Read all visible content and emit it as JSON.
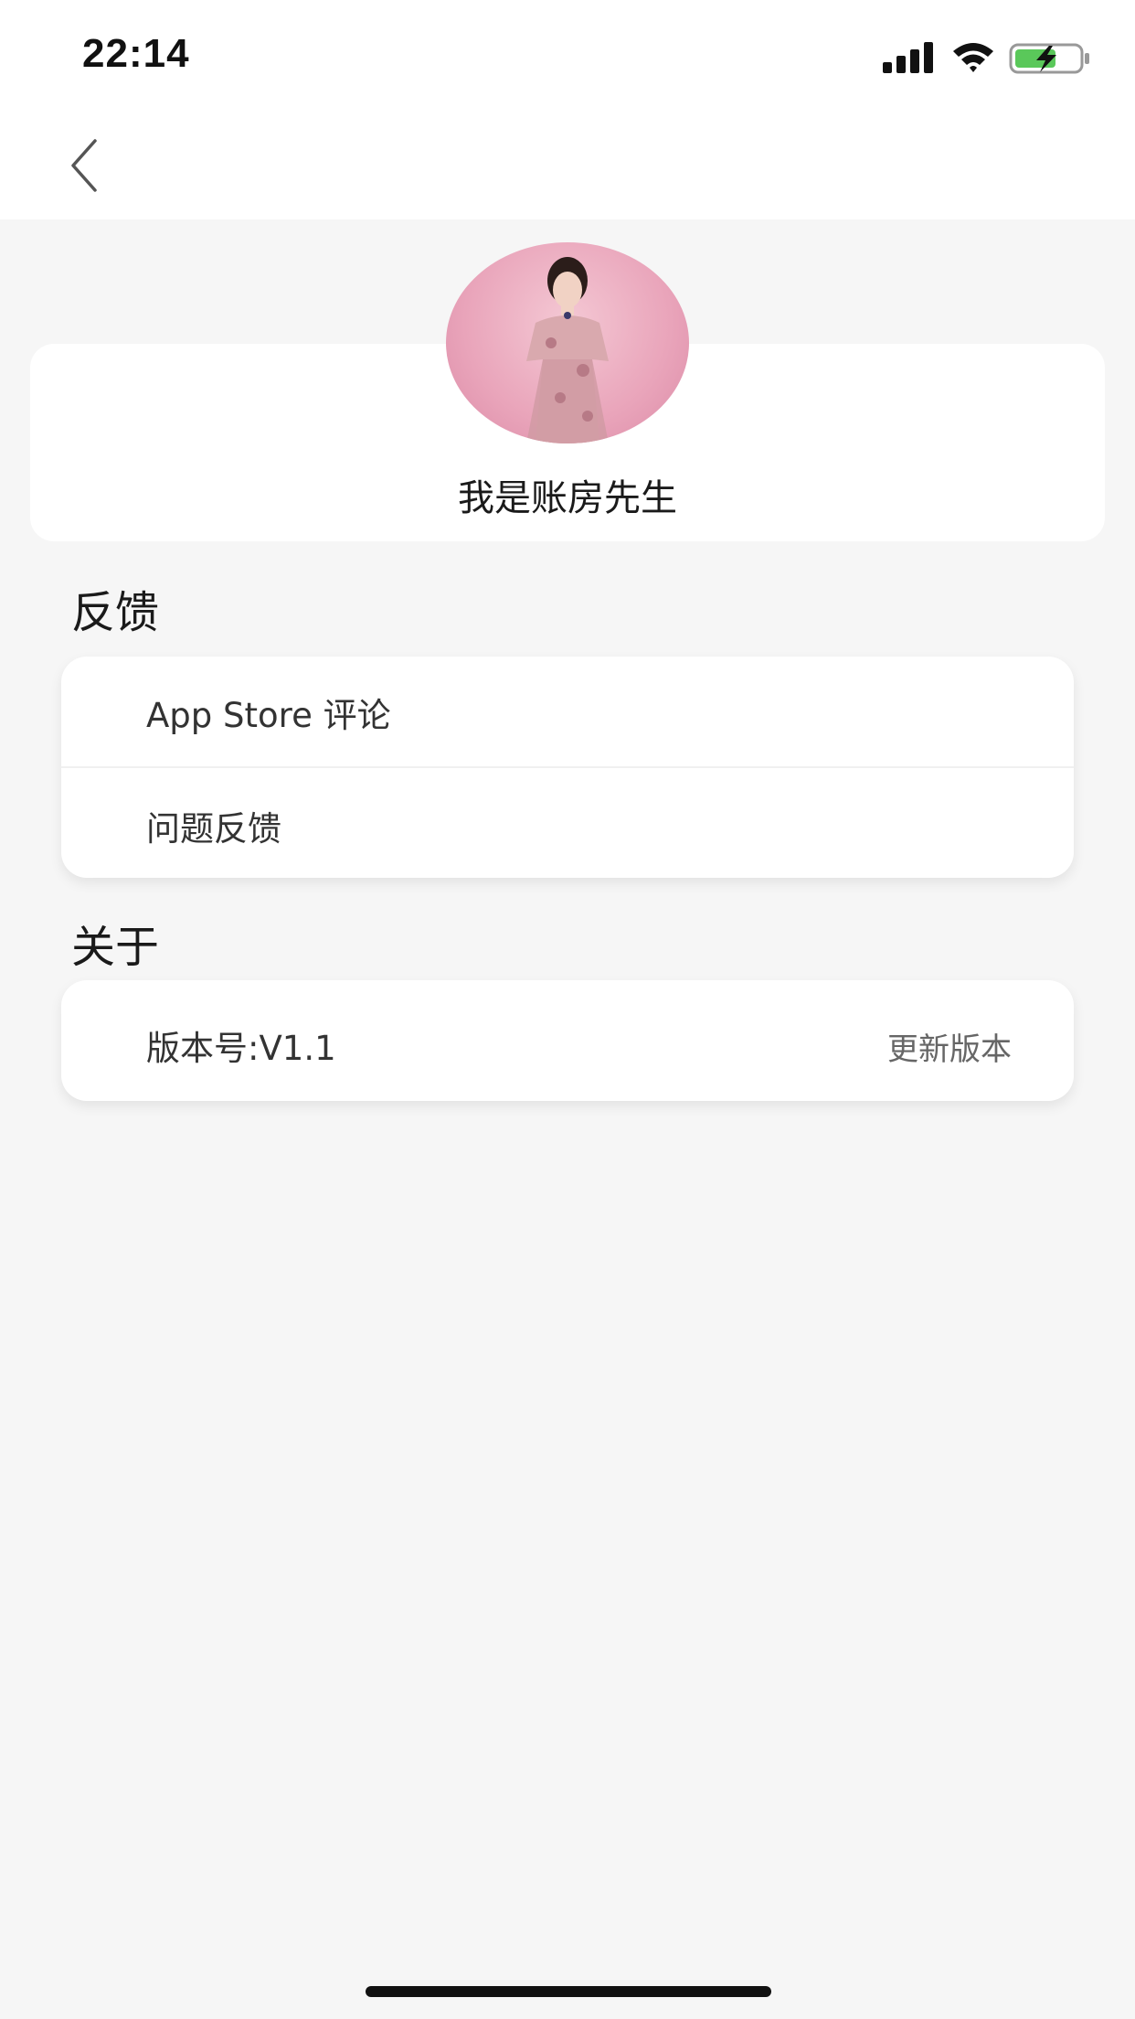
{
  "status_bar": {
    "time": "22:14",
    "icons": [
      "signal-icon",
      "wifi-icon",
      "battery-charging-icon"
    ]
  },
  "nav": {
    "back_icon": "chevron-left-icon"
  },
  "profile": {
    "avatar": "user-photo",
    "name": "我是账房先生"
  },
  "sections": {
    "feedback": {
      "title": "反馈",
      "items": [
        {
          "label": "App Store 评论"
        },
        {
          "label": "问题反馈"
        }
      ]
    },
    "about": {
      "title": "关于",
      "version_label": "版本号:V1.1",
      "update_label": "更新版本"
    }
  },
  "colors": {
    "background": "#f6f6f6",
    "card": "#ffffff",
    "text_primary": "#1a1a1a",
    "text_secondary": "#666666",
    "battery_charge": "#5ac85a"
  }
}
